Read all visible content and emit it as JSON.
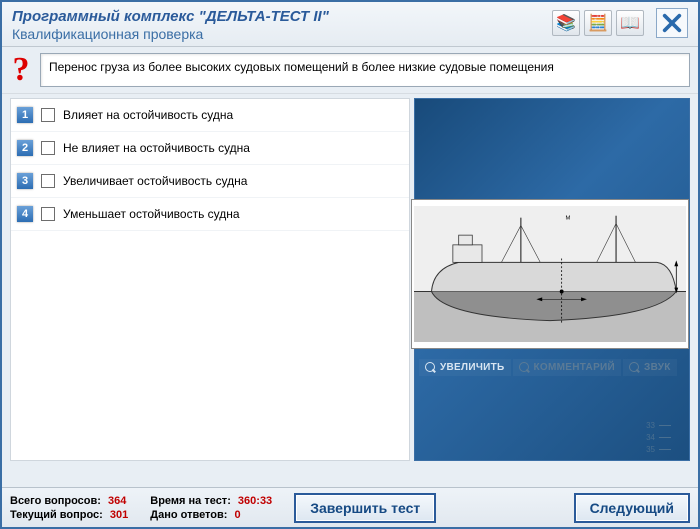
{
  "header": {
    "app_title": "Программный комплекс \"ДЕЛЬТА-ТЕСТ II\"",
    "sub_title": "Квалификационная проверка",
    "icons": {
      "docs": "📚",
      "calc": "🧮",
      "help": "📖"
    }
  },
  "question": {
    "text": "Перенос груза из более высоких судовых помещений в более низкие судовые помещения"
  },
  "answers": [
    {
      "num": "1",
      "label": "Влияет на остойчивость судна"
    },
    {
      "num": "2",
      "label": "Не влияет на остойчивость судна"
    },
    {
      "num": "3",
      "label": "Увеличивает остойчивость судна"
    },
    {
      "num": "4",
      "label": "Уменьшает остойчивость судна"
    }
  ],
  "media": {
    "zoom": "УВЕЛИЧИТЬ",
    "comment": "КОММЕНТАРИЙ",
    "sound": "ЗВУК",
    "scale": [
      "33",
      "34",
      "35"
    ]
  },
  "footer": {
    "total_q_label": "Всего вопросов:",
    "total_q_val": "364",
    "current_q_label": "Текущий вопрос:",
    "current_q_val": "301",
    "time_label": "Время на тест:",
    "time_val": "360:33",
    "answered_label": "Дано ответов:",
    "answered_val": "0",
    "finish_btn": "Завершить тест",
    "next_btn": "Следующий"
  }
}
